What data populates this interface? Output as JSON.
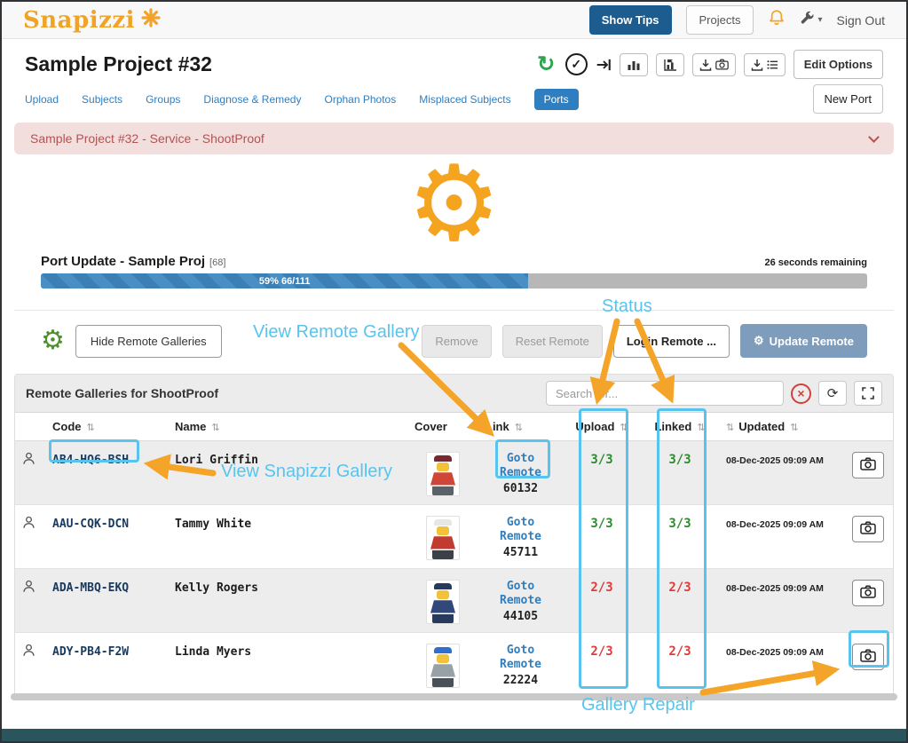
{
  "topbar": {
    "logo": "Snapizzi",
    "show_tips_label": "Show Tips",
    "projects_label": "Projects",
    "sign_out_label": "Sign Out"
  },
  "page": {
    "title": "Sample Project #32",
    "edit_options_label": "Edit Options",
    "new_port_label": "New Port"
  },
  "tabs": {
    "upload": "Upload",
    "subjects": "Subjects",
    "groups": "Groups",
    "diagnose": "Diagnose & Remedy",
    "orphan": "Orphan Photos",
    "misplaced": "Misplaced Subjects",
    "ports": "Ports"
  },
  "alert": {
    "title": "Sample Project #32 - Service - ShootProof"
  },
  "progress": {
    "title": "Port Update - Sample Proj",
    "badge": "[68]",
    "remaining": "26 seconds remaining",
    "percent": 59,
    "label": "59% 66/111"
  },
  "toolbar": {
    "hide_remote_label": "Hide Remote Galleries",
    "remove_label": "Remove",
    "reset_remote_label": "Reset Remote",
    "login_remote_label": "Login Remote ...",
    "update_remote_label": "Update Remote"
  },
  "table": {
    "title": "Remote Galleries for ShootProof",
    "search_placeholder": "Search for...",
    "columns": {
      "code": "Code",
      "name": "Name",
      "cover": "Cover",
      "link": "Link",
      "upload": "Upload",
      "linked": "Linked",
      "updated": "Updated"
    },
    "rows": [
      {
        "code": "AB4-HQ6-BSH",
        "name": "Lori Griffin",
        "link": "Goto Remote",
        "remote_id": "60132",
        "upload": "3/3",
        "linked": "3/3",
        "updated": "08-Dec-2025 09:09 AM",
        "cover": {
          "hat": "#7a2730",
          "torso": "#cf4638",
          "legs": "#5b6168"
        }
      },
      {
        "code": "AAU-CQK-DCN",
        "name": "Tammy White",
        "link": "Goto Remote",
        "remote_id": "45711",
        "upload": "3/3",
        "linked": "3/3",
        "updated": "08-Dec-2025 09:09 AM",
        "cover": {
          "hat": "#e8e6e0",
          "torso": "#c23b31",
          "legs": "#3c4148"
        }
      },
      {
        "code": "ADA-MBQ-EKQ",
        "name": "Kelly Rogers",
        "link": "Goto Remote",
        "remote_id": "44105",
        "upload": "2/3",
        "linked": "2/3",
        "updated": "08-Dec-2025 09:09 AM",
        "cover": {
          "hat": "#273a5e",
          "torso": "#32477a",
          "legs": "#273a5e"
        }
      },
      {
        "code": "ADY-PB4-F2W",
        "name": "Linda Myers",
        "link": "Goto Remote",
        "remote_id": "22224",
        "upload": "2/3",
        "linked": "2/3",
        "updated": "08-Dec-2025 09:09 AM",
        "cover": {
          "hat": "#2f6fce",
          "torso": "#98a0a8",
          "legs": "#4a5057"
        }
      }
    ]
  },
  "annotations": {
    "view_remote_gallery": "View Remote Gallery",
    "status": "Status",
    "view_snapizzi_gallery": "View Snapizzi Gallery",
    "gallery_repair": "Gallery Repair"
  },
  "icons": {
    "sort": "⇅",
    "gear": "⚙",
    "check": "✓",
    "sync": "↻",
    "refresh": "⟳",
    "clear": "×",
    "caret": "▾"
  },
  "colors": {
    "accent_orange": "#F2A32B",
    "annotation_blue": "#58C4EE",
    "brand_blue": "#2F7EC0",
    "status_ok": "#2E8B2E",
    "status_bad": "#E03A3A",
    "progress_fill": "#4A8FC4",
    "alert_bg": "#F3DEDE",
    "alert_text": "#B05452"
  }
}
